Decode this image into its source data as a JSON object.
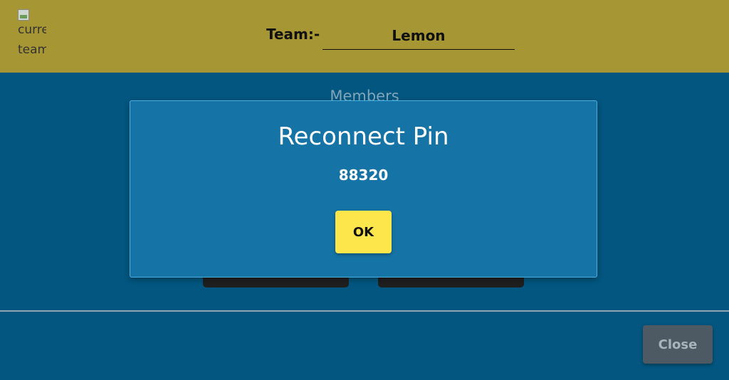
{
  "header": {
    "team_image_alt_lines": [
      "curre",
      "team"
    ],
    "team_label": "Team:-",
    "team_name": "Lemon"
  },
  "main": {
    "members_heading": "Members"
  },
  "footer": {
    "close_label": "Close"
  },
  "modal": {
    "title": "Reconnect Pin",
    "pin": "88320",
    "ok_label": "OK"
  },
  "colors": {
    "header_bg": "#a69634",
    "page_bg": "#02567f",
    "modal_bg": "#1573a5",
    "ok_button": "#fde64b",
    "close_button": "#4d5a63"
  }
}
